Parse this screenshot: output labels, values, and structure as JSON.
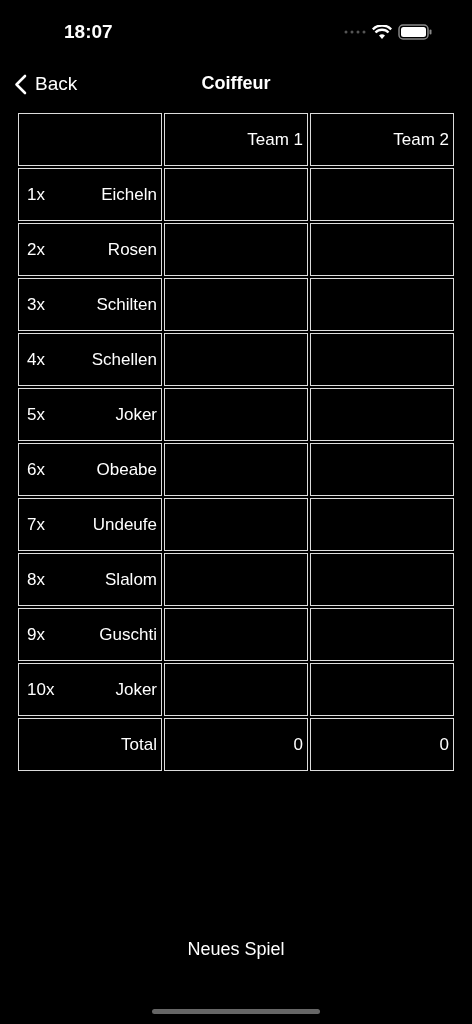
{
  "status_bar": {
    "time": "18:07"
  },
  "nav": {
    "back": "Back",
    "title": "Coiffeur"
  },
  "table": {
    "columns": [
      "Team 1",
      "Team 2"
    ],
    "rows": [
      {
        "multiplier": "1x",
        "name": "Eicheln"
      },
      {
        "multiplier": "2x",
        "name": "Rosen"
      },
      {
        "multiplier": "3x",
        "name": "Schilten"
      },
      {
        "multiplier": "4x",
        "name": "Schellen"
      },
      {
        "multiplier": "5x",
        "name": "Joker"
      },
      {
        "multiplier": "6x",
        "name": "Obeabe"
      },
      {
        "multiplier": "7x",
        "name": "Undeufe"
      },
      {
        "multiplier": "8x",
        "name": "Slalom"
      },
      {
        "multiplier": "9x",
        "name": "Guschti"
      },
      {
        "multiplier": "10x",
        "name": "Joker"
      }
    ],
    "total": {
      "label": "Total",
      "values": [
        "0",
        "0"
      ]
    }
  },
  "button": "Neues Spiel"
}
